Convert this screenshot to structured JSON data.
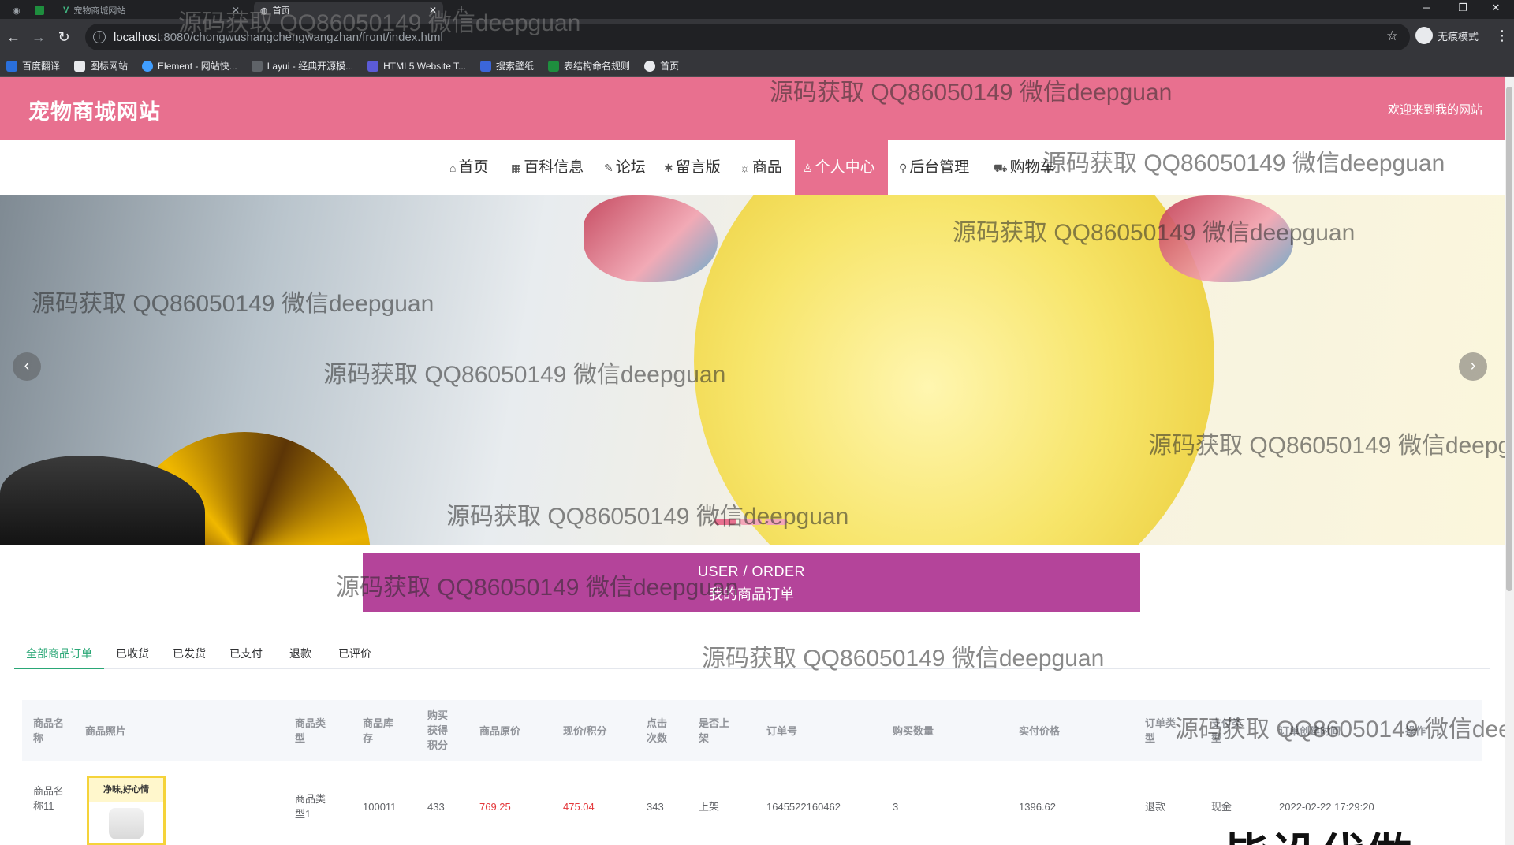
{
  "browser": {
    "tabs": [
      {
        "title": "宠物商城网站",
        "active": false
      },
      {
        "title": "首页",
        "active": true
      }
    ],
    "url_host": "localhost",
    "url_rest": ":8080/chongwushangchengwangzhan/front/index.html",
    "profile_label": "无痕模式",
    "bookmarks": [
      "百度翻译",
      "图标网站",
      "Element - 网站快...",
      "Layui - 经典开源模...",
      "HTML5 Website T...",
      "搜索壁纸",
      "表结构命名规则",
      "首页"
    ]
  },
  "site": {
    "title": "宠物商城网站",
    "welcome": "欢迎来到我的网站"
  },
  "nav": [
    {
      "icon": "⌂",
      "label": "首页"
    },
    {
      "icon": "▦",
      "label": "百科信息"
    },
    {
      "icon": "✎",
      "label": "论坛"
    },
    {
      "icon": "✱",
      "label": "留言版"
    },
    {
      "icon": "☼",
      "label": "商品"
    },
    {
      "icon": "♙",
      "label": "个人中心"
    },
    {
      "icon": "⚲",
      "label": "后台管理"
    },
    {
      "icon": "⛟",
      "label": "购物车"
    }
  ],
  "active_nav": "个人中心",
  "order_banner": {
    "en": "USER / ORDER",
    "cn": "我的商品订单"
  },
  "order_tabs": [
    "全部商品订单",
    "已收货",
    "已发货",
    "已支付",
    "退款",
    "已评价"
  ],
  "table": {
    "headers": [
      "商品名称",
      "商品照片",
      "商品类型",
      "商品库存",
      "购买获得积分",
      "商品原价",
      "现价/积分",
      "点击次数",
      "是否上架",
      "订单号",
      "购买数量",
      "实付价格",
      "订单类型",
      "支付类型",
      "订单创建时间",
      "操作"
    ],
    "rows": [
      {
        "name": "商品名称11",
        "image_caption": "净味,好心情",
        "type": "商品类型1",
        "stock": "100011",
        "points": "433",
        "original_price": "769.25",
        "current_price": "475.04",
        "clicks": "343",
        "on_shelf": "上架",
        "order_no": "1645522160462",
        "quantity": "3",
        "paid": "1396.62",
        "order_type": "退款",
        "pay_type": "现金",
        "created": "2022-02-22 17:29:20"
      }
    ]
  },
  "watermark": "源码获取 QQ86050149 微信deepguan",
  "promo": "毕设代做",
  "colors": {
    "brand_pink": "#e8708f",
    "order_purple": "#b4449a",
    "tab_green": "#2aa776",
    "price_red": "#e4393c"
  }
}
